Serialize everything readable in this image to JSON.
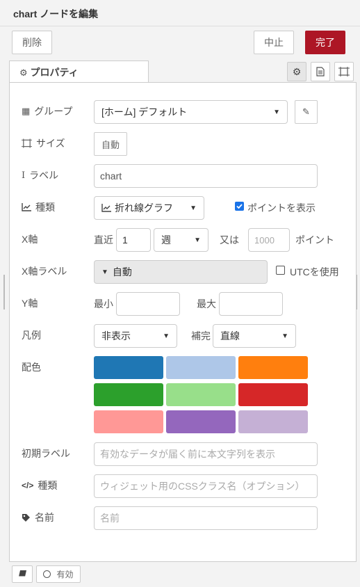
{
  "header": {
    "title": "chart ノードを編集",
    "delete_label": "削除",
    "cancel_label": "中止",
    "done_label": "完了"
  },
  "tabs": {
    "properties_label": "プロパティ"
  },
  "form": {
    "group": {
      "label": "グループ",
      "value": "[ホーム] デフォルト"
    },
    "size": {
      "label": "サイズ",
      "value": "自動"
    },
    "label": {
      "label": "ラベル",
      "value": "chart"
    },
    "type": {
      "label": "種類",
      "value": "折れ線グラフ",
      "show_points_label": "ポイントを表示",
      "show_points_checked": true
    },
    "xaxis": {
      "label": "X軸",
      "recent_label": "直近",
      "count": "1",
      "unit": "週",
      "or_label": "又は",
      "points_placeholder": "1000",
      "points_label": "ポイント"
    },
    "xaxis_label": {
      "label": "X軸ラベル",
      "value": "自動",
      "utc_label": "UTCを使用",
      "utc_checked": false
    },
    "yaxis": {
      "label": "Y軸",
      "min_label": "最小",
      "max_label": "最大"
    },
    "legend": {
      "label": "凡例",
      "value": "非表示",
      "interp_label": "補完",
      "interp_value": "直線"
    },
    "colors": {
      "label": "配色",
      "swatches": [
        "#1f77b4",
        "#aec7e8",
        "#ff7f0e",
        "#2ca02c",
        "#98df8a",
        "#d62728",
        "#ff9896",
        "#9467bd",
        "#c5b0d5"
      ]
    },
    "initial_label": {
      "label": "初期ラベル",
      "placeholder": "有効なデータが届く前に本文字列を表示"
    },
    "css_class": {
      "label": "種類",
      "placeholder": "ウィジェット用のCSSクラス名（オプション）"
    },
    "name": {
      "label": "名前",
      "placeholder": "名前"
    }
  },
  "footer": {
    "enabled_label": "有効"
  },
  "colors": {
    "accent": "#ad1625",
    "checkbox": "#1a73e8"
  }
}
